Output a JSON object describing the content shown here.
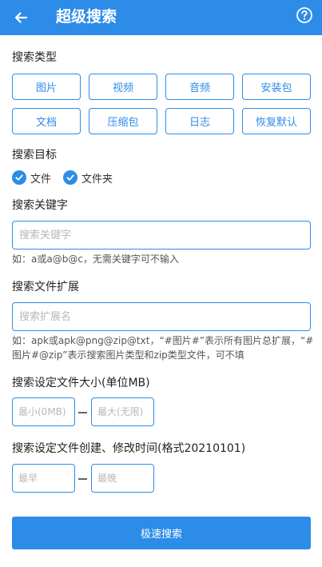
{
  "header": {
    "title": "超级搜索",
    "back_icon": "back-arrow-icon",
    "help_icon": "help-circle-icon",
    "background_color": "#2d8ce8"
  },
  "search_type": {
    "title": "搜索类型",
    "buttons": [
      "图片",
      "视频",
      "音频",
      "安装包",
      "文档",
      "压缩包",
      "日志",
      "恢复默认"
    ]
  },
  "search_target": {
    "title": "搜索目标",
    "options": [
      {
        "label": "文件",
        "checked": true
      },
      {
        "label": "文件夹",
        "checked": true
      }
    ]
  },
  "keyword": {
    "title": "搜索关键字",
    "placeholder": "搜索关键字",
    "value": "",
    "hint": "如：a或a@b@c，无需关键字可不输入"
  },
  "extension": {
    "title": "搜索文件扩展",
    "placeholder": "搜索扩展名",
    "value": "",
    "hint": "如：apk或apk@png@zip@txt，“#图片#”表示所有图片总扩展，“#图片#@zip”表示搜索图片类型和zip类型文件，可不填"
  },
  "size": {
    "title": "搜索设定文件大小(单位MB)",
    "min_placeholder": "最小(0MB)",
    "max_placeholder": "最大(无限)"
  },
  "time": {
    "title": "搜索设定文件创建、修改时间(格式20210101)",
    "start_placeholder": "最早",
    "end_placeholder": "最晚"
  },
  "submit_label": "极速搜索",
  "accent_color": "#2d8ce8"
}
